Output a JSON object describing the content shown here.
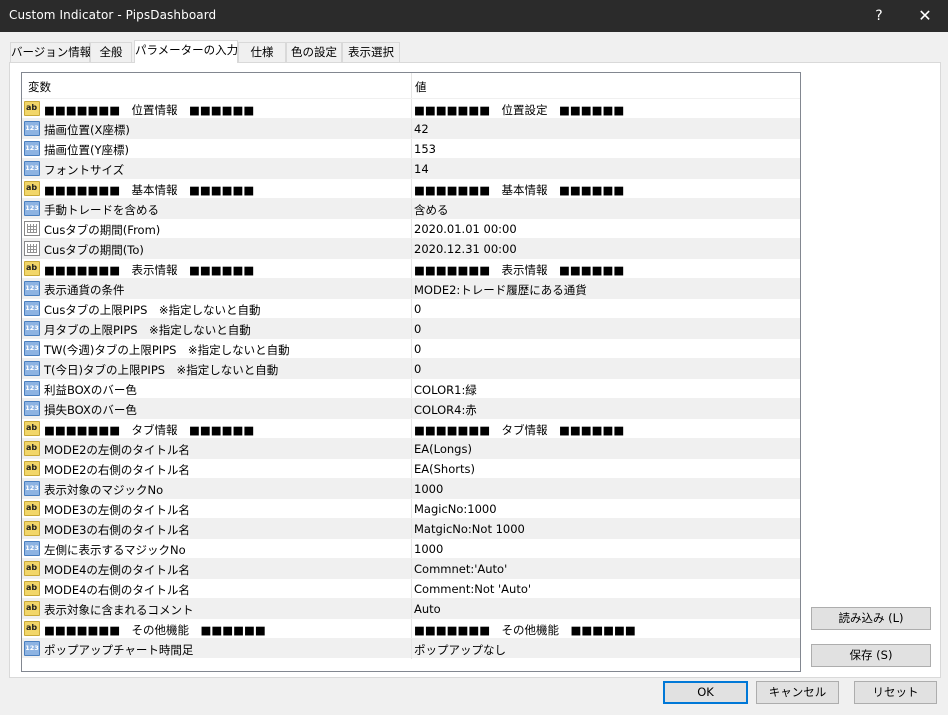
{
  "window": {
    "title": "Custom Indicator - PipsDashboard",
    "help_label": "?",
    "close_label": "✕"
  },
  "tabs": [
    {
      "label": "バージョン情報"
    },
    {
      "label": "全般"
    },
    {
      "label": "パラメーターの入力"
    },
    {
      "label": "仕様"
    },
    {
      "label": "色の設定"
    },
    {
      "label": "表示選択"
    }
  ],
  "grid": {
    "columns": {
      "variable": "変数",
      "value": "値"
    },
    "rows": [
      {
        "icon": "ab",
        "name": "■■■■■■■　位置情報　■■■■■■",
        "value": "■■■■■■■　位置設定　■■■■■■"
      },
      {
        "icon": "123",
        "name": "描画位置(X座標)",
        "value": "42"
      },
      {
        "icon": "123",
        "name": "描画位置(Y座標)",
        "value": "153"
      },
      {
        "icon": "123",
        "name": "フォントサイズ",
        "value": "14"
      },
      {
        "icon": "ab",
        "name": "■■■■■■■　基本情報　■■■■■■",
        "value": "■■■■■■■　基本情報　■■■■■■"
      },
      {
        "icon": "123",
        "name": "手動トレードを含める",
        "value": "含める"
      },
      {
        "icon": "cal",
        "name": "Cusタブの期間(From)",
        "value": "2020.01.01 00:00"
      },
      {
        "icon": "cal",
        "name": "Cusタブの期間(To)",
        "value": "2020.12.31 00:00"
      },
      {
        "icon": "ab",
        "name": "■■■■■■■　表示情報　■■■■■■",
        "value": "■■■■■■■　表示情報　■■■■■■"
      },
      {
        "icon": "123",
        "name": "表示通貨の条件",
        "value": "MODE2:トレード履歴にある通貨"
      },
      {
        "icon": "123",
        "name": "Cusタブの上限PIPS　※指定しないと自動",
        "value": "0"
      },
      {
        "icon": "123",
        "name": "月タブの上限PIPS　※指定しないと自動",
        "value": "0"
      },
      {
        "icon": "123",
        "name": "TW(今週)タブの上限PIPS　※指定しないと自動",
        "value": "0"
      },
      {
        "icon": "123",
        "name": "T(今日)タブの上限PIPS　※指定しないと自動",
        "value": "0"
      },
      {
        "icon": "123",
        "name": "利益BOXのバー色",
        "value": "COLOR1:緑"
      },
      {
        "icon": "123",
        "name": "損失BOXのバー色",
        "value": "COLOR4:赤"
      },
      {
        "icon": "ab",
        "name": "■■■■■■■　タブ情報　■■■■■■",
        "value": "■■■■■■■　タブ情報　■■■■■■"
      },
      {
        "icon": "ab",
        "name": "MODE2の左側のタイトル名",
        "value": "EA(Longs)"
      },
      {
        "icon": "ab",
        "name": "MODE2の右側のタイトル名",
        "value": "EA(Shorts)"
      },
      {
        "icon": "123",
        "name": "表示対象のマジックNo",
        "value": "1000"
      },
      {
        "icon": "ab",
        "name": "MODE3の左側のタイトル名",
        "value": "MagicNo:1000"
      },
      {
        "icon": "ab",
        "name": "MODE3の右側のタイトル名",
        "value": "MatgicNo:Not 1000"
      },
      {
        "icon": "123",
        "name": "左側に表示するマジックNo",
        "value": "1000"
      },
      {
        "icon": "ab",
        "name": "MODE4の左側のタイトル名",
        "value": "Commnet:'Auto'"
      },
      {
        "icon": "ab",
        "name": "MODE4の右側のタイトル名",
        "value": "Comment:Not 'Auto'"
      },
      {
        "icon": "ab",
        "name": "表示対象に含まれるコメント",
        "value": "Auto"
      },
      {
        "icon": "ab",
        "name": "■■■■■■■　その他機能　■■■■■■",
        "value": "■■■■■■■　その他機能　■■■■■■"
      },
      {
        "icon": "123",
        "name": "ポップアップチャート時間足",
        "value": "ポップアップなし"
      }
    ]
  },
  "side_buttons": {
    "load_label": "読み込み (L)",
    "save_label": "保存 (S)"
  },
  "footer": {
    "ok_label": "OK",
    "cancel_label": "キャンセル",
    "reset_label": "リセット"
  },
  "icon_labels": {
    "ab": "ab",
    "123": "123"
  }
}
